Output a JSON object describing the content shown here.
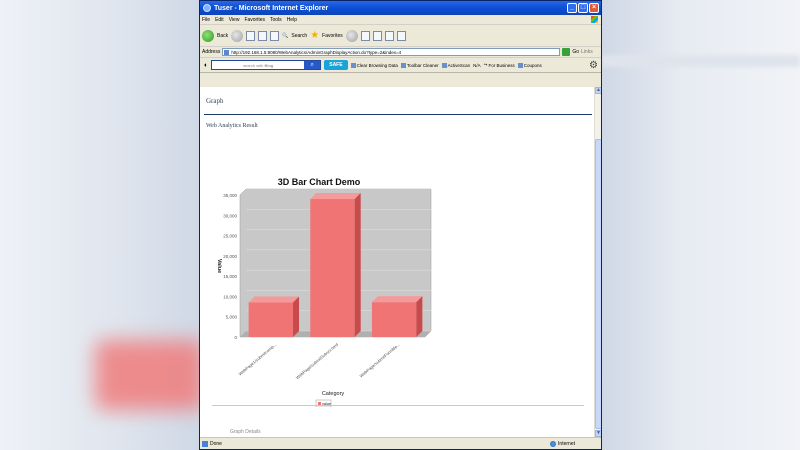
{
  "window": {
    "title": "Tuser - Microsoft Internet Explorer"
  },
  "menu": [
    "File",
    "Edit",
    "View",
    "Favorites",
    "Tools",
    "Help"
  ],
  "toolbar": {
    "back_label": "Back",
    "search_label": "Search",
    "favorites_label": "Favorites"
  },
  "address": {
    "label": "Address",
    "url": "http://192.168.1.5:8080/WebAnalytics/AdminGraphDisplayAction.do?type=2&index=4",
    "go_label": "Go",
    "links_label": "Links"
  },
  "searchbar": {
    "placeholder": "search with",
    "brand": "Bing",
    "safe_label": "SAFE",
    "items": [
      "Clear Browsing Data",
      "Toolbar Cleaner",
      "ActiveScan",
      "N/A",
      "For Business",
      "Coupons"
    ]
  },
  "page": {
    "heading": "Graph",
    "section": "Web Analytics Result",
    "cut_text": "Graph Details",
    "status": "Done",
    "zone": "Internet"
  },
  "colors": {
    "bar": "#f07474",
    "bar_side": "#c94a4a",
    "bar_top": "#f59a9a",
    "plot_bg": "#c8c8c8"
  },
  "chart_data": {
    "type": "bar",
    "title": "3D Bar Chart Demo",
    "xlabel": "Category",
    "ylabel": "Value",
    "categories": [
      "WebPage1/submitcomp...",
      "WebPage/submitSubscr.html",
      "WebPage/submitFormMe..."
    ],
    "series": [
      {
        "name": "value",
        "values": [
          8500,
          34000,
          8600
        ]
      }
    ],
    "ylim": [
      0,
      35000
    ],
    "yticks": [
      "0",
      "5,000",
      "10,000",
      "15,000",
      "20,000",
      "25,000",
      "30,000",
      "35,000"
    ],
    "grid": true,
    "legend": "bottom"
  }
}
